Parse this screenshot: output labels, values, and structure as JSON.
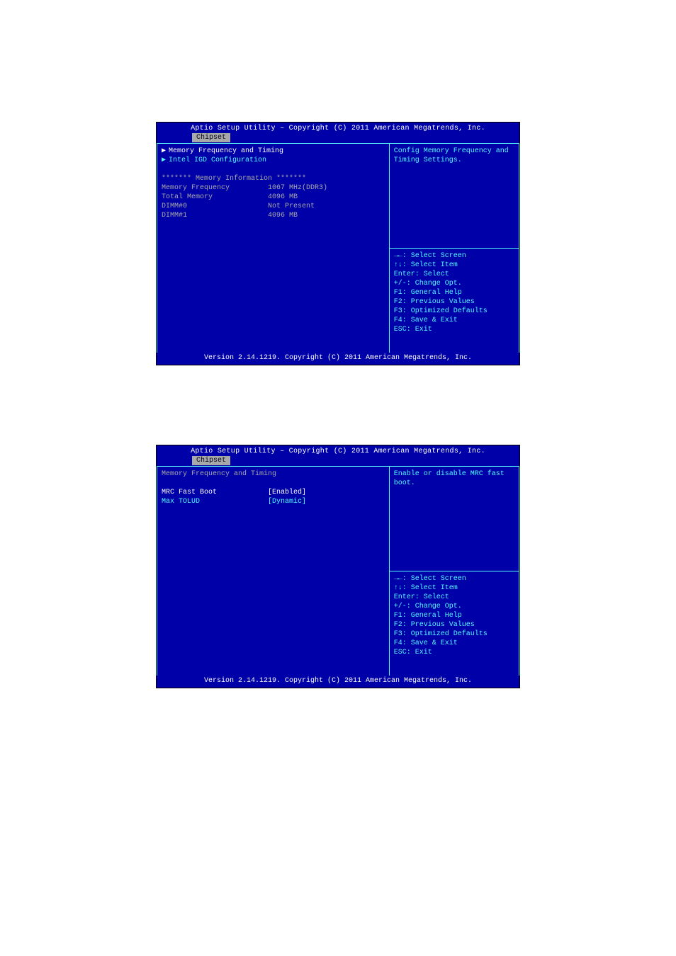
{
  "screen1": {
    "title": "Aptio Setup Utility – Copyright (C) 2011 American Megatrends, Inc.",
    "tab": "Chipset",
    "menu": {
      "mem_freq_timing": "Memory Frequency and Timing",
      "intel_igd": "Intel IGD Configuration"
    },
    "section_header": "******* Memory Information *******",
    "info": {
      "mem_freq_label": "Memory Frequency",
      "mem_freq_value": "1067 MHz(DDR3)",
      "total_mem_label": "Total Memory",
      "total_mem_value": "4096 MB",
      "dimm0_label": "DIMM#0",
      "dimm0_value": "Not Present",
      "dimm1_label": "DIMM#1",
      "dimm1_value": "4096 MB"
    },
    "help_text": "Config Memory Frequency and Timing Settings.",
    "footer": "Version 2.14.1219. Copyright (C) 2011 American Megatrends, Inc."
  },
  "screen2": {
    "title": "Aptio Setup Utility – Copyright (C) 2011 American Megatrends, Inc.",
    "tab": "Chipset",
    "section_title": "Memory Frequency and Timing",
    "options": {
      "mrc_label": "MRC Fast Boot",
      "mrc_value": "[Enabled]",
      "tolud_label": "Max TOLUD",
      "tolud_value": "[Dynamic]"
    },
    "help_text": "Enable or disable MRC fast boot.",
    "footer": "Version 2.14.1219. Copyright (C) 2011 American Megatrends, Inc."
  },
  "nav_help": {
    "select_screen": "→←: Select Screen",
    "select_item": "↑↓: Select Item",
    "enter": "Enter: Select",
    "change": "+/-: Change Opt.",
    "f1": "F1: General Help",
    "f2": "F2: Previous Values",
    "f3": "F3: Optimized Defaults",
    "f4": "F4: Save & Exit",
    "esc": "ESC: Exit"
  }
}
